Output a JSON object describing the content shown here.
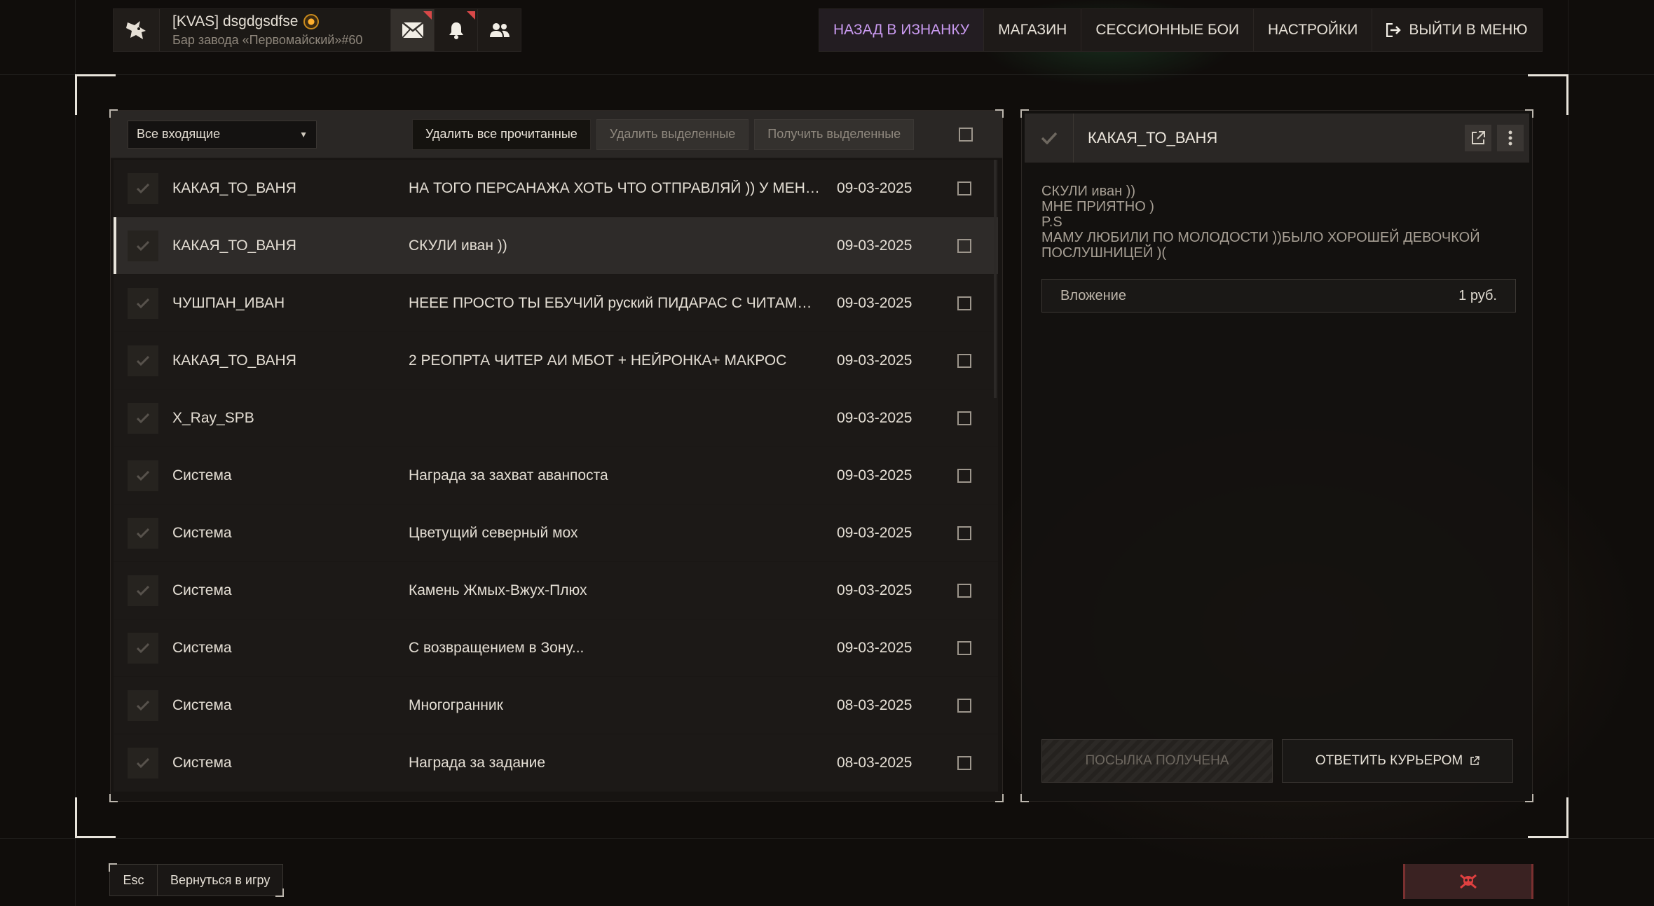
{
  "profile": {
    "name": "[KVAS] dsgdgsdfse",
    "location": "Бар завода «Первомайский»#60"
  },
  "topnav": {
    "items": [
      {
        "label": "НАЗАД В ИЗНАНКУ"
      },
      {
        "label": "МАГАЗИН"
      },
      {
        "label": "СЕССИОННЫЕ БОИ"
      },
      {
        "label": "НАСТРОЙКИ"
      },
      {
        "label": "ВЫЙТИ В МЕНЮ"
      }
    ]
  },
  "inbox": {
    "filter": "Все входящие",
    "delete_read": "Удалить все прочитанные",
    "delete_selected": "Удалить выделенные",
    "receive_selected": "Получить выделенные",
    "messages": [
      {
        "sender": "КАКАЯ_ТО_ВАНЯ",
        "subject": "НА ТОГО ПЕРСАНАЖА ХОТЬ ЧТО ОТПРАВЛЯЙ )) У МЕНЯ И...",
        "date": "09-03-2025"
      },
      {
        "sender": "КАКАЯ_ТО_ВАНЯ",
        "subject": "СКУЛИ иван ))",
        "date": "09-03-2025"
      },
      {
        "sender": "ЧУШПАН_ИВАН",
        "subject": "НЕЕЕ ПРОСТО ТЫ ЕБУЧИЙ руский ПИДАРАС С ЧИТАМИ ! У ...",
        "date": "09-03-2025"
      },
      {
        "sender": "КАКАЯ_ТО_ВАНЯ",
        "subject": "2 РЕОПРТА ЧИТЕР АИ МБОТ + НЕЙРОНКА+ МАКРОС",
        "date": "09-03-2025"
      },
      {
        "sender": "X_Ray_SPB",
        "subject": "",
        "date": "09-03-2025"
      },
      {
        "sender": "Система",
        "subject": "Награда за захват аванпоста",
        "date": "09-03-2025"
      },
      {
        "sender": "Система",
        "subject": "Цветущий северный мох",
        "date": "09-03-2025"
      },
      {
        "sender": "Система",
        "subject": "Камень Жмых-Вжух-Плюх",
        "date": "09-03-2025"
      },
      {
        "sender": "Система",
        "subject": "С возвращением в Зону...",
        "date": "09-03-2025"
      },
      {
        "sender": "Система",
        "subject": "Многогранник",
        "date": "08-03-2025"
      },
      {
        "sender": "Система",
        "subject": "Награда за задание",
        "date": "08-03-2025"
      }
    ]
  },
  "message": {
    "title": "КАКАЯ_ТО_ВАНЯ",
    "body": "СКУЛИ иван ))\nМНЕ ПРИЯТНО )\nP.S\nМАМУ ЛЮБИЛИ ПО МОЛОДОСТИ ))БЫЛО ХОРОШЕЙ ДЕВОЧКОЙ ПОСЛУШНИЦЕЙ )(",
    "attachment_label": "Вложение",
    "attachment_value": "1 руб.",
    "received_button": "ПОСЫЛКА ПОЛУЧЕНА",
    "reply_button": "ОТВЕТИТЬ КУРЬЕРОМ"
  },
  "bottom": {
    "esc_key": "Esc",
    "back_label": "Вернуться в игру"
  },
  "colors": {
    "accent_nav": "#c99af0",
    "notification": "#d84848",
    "report": "#e04040"
  }
}
